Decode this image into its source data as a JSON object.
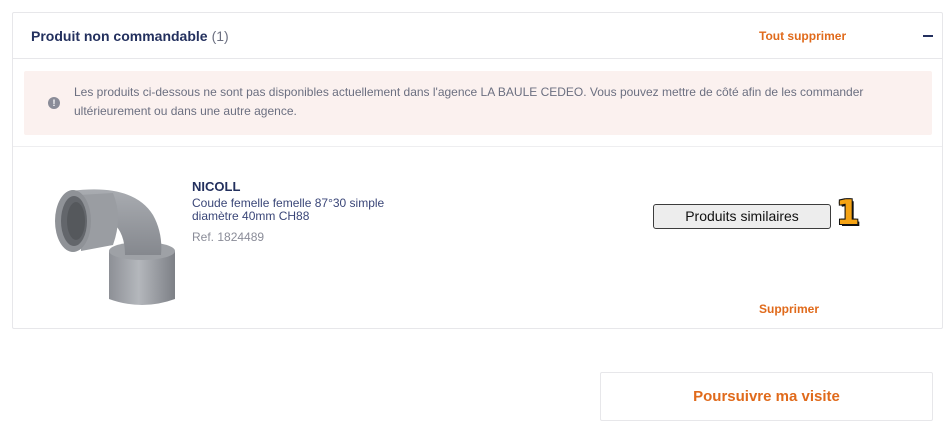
{
  "section": {
    "title": "Produit non commandable",
    "count": "(1)",
    "remove_all_label": "Tout supprimer"
  },
  "notice": {
    "icon": "info-icon",
    "text": "Les produits ci-dessous ne sont pas disponibles actuellement dans l'agence LA BAULE CEDEO. Vous pouvez mettre de côté afin de les commander ultérieurement ou dans une autre agence."
  },
  "product": {
    "brand": "NICOLL",
    "description": "Coude femelle femelle 87°30 simple diamètre 40mm CH88",
    "reference": "Ref. 1824489",
    "similar_label": "Produits similaires",
    "remove_label": "Supprimer"
  },
  "annotation": {
    "step": "1"
  },
  "footer": {
    "continue_label": "Poursuivre ma visite"
  },
  "colors": {
    "brand_navy": "#23305e",
    "accent_orange": "#e06a1b",
    "notice_bg": "#fbf1ef",
    "badge_orange": "#f5a314"
  }
}
